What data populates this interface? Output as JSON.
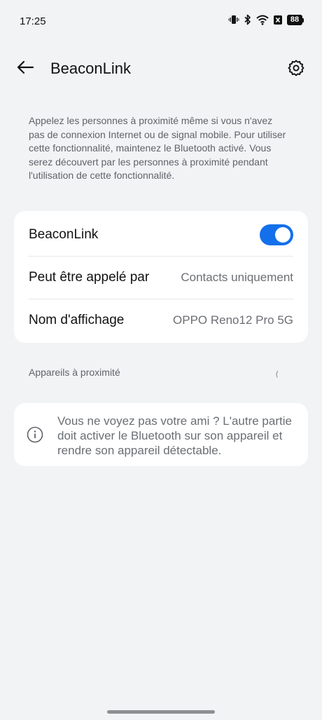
{
  "status_bar": {
    "time": "17:25",
    "battery": "88",
    "icons": [
      "vibrate-icon",
      "bluetooth-icon",
      "wifi-icon",
      "no-sim-icon",
      "battery-icon"
    ]
  },
  "app_bar": {
    "title": "BeaconLink",
    "back_icon": "arrow-left-icon",
    "settings_icon": "gear-icon"
  },
  "description": "Appelez les personnes à proximité même si vous n'avez pas de connexion Internet ou de signal mobile. Pour utiliser cette fonctionnalité, maintenez le Bluetooth activé. Vous serez découvert par les personnes à proximité pendant l'utilisation de cette fonctionnalité.",
  "settings": {
    "beaconlink": {
      "label": "BeaconLink",
      "enabled": true,
      "accent_color": "#1470ea"
    },
    "callable_by": {
      "label": "Peut être appelé par",
      "value": "Contacts uniquement"
    },
    "display_name": {
      "label": "Nom d'affichage",
      "value": "OPPO Reno12 Pro 5G"
    }
  },
  "nearby": {
    "header": "Appareils à proximité"
  },
  "info": {
    "icon": "info-icon",
    "text": "Vous ne voyez pas votre ami ? L'autre partie doit activer le Bluetooth sur son appareil et rendre son appareil détectable."
  }
}
